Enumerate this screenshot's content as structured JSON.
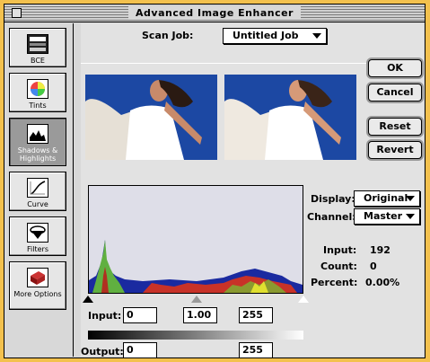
{
  "window": {
    "title": "Advanced Image Enhancer"
  },
  "sidebar": {
    "items": [
      {
        "label": "BCE"
      },
      {
        "label": "Tints"
      },
      {
        "label": "Shadows & Highlights"
      },
      {
        "label": "Curve"
      },
      {
        "label": "Filters"
      },
      {
        "label": "More Options"
      }
    ]
  },
  "scan_job": {
    "label": "Scan Job:",
    "value": "Untitled Job"
  },
  "buttons": {
    "ok": "OK",
    "cancel": "Cancel",
    "reset": "Reset",
    "revert": "Revert"
  },
  "display": {
    "label": "Display:",
    "value": "Original"
  },
  "channel": {
    "label": "Channel:",
    "value": "Master"
  },
  "info": {
    "input_label": "Input:",
    "input_value": "192",
    "count_label": "Count:",
    "count_value": "0",
    "percent_label": "Percent:",
    "percent_value": "0.00%"
  },
  "levels": {
    "input_label": "Input:",
    "input_black": "0",
    "input_gamma": "1.00",
    "input_white": "255",
    "output_label": "Output:",
    "output_black": "0",
    "output_white": "255"
  },
  "colors": {
    "background": "#f3c14e",
    "sky": "#1c48a3"
  }
}
